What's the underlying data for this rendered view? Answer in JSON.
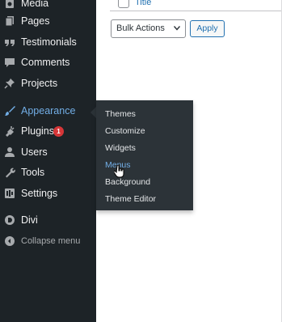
{
  "sidebar": {
    "items": [
      {
        "label": "Media",
        "icon": "media-icon"
      },
      {
        "label": "Pages",
        "icon": "pages-icon"
      },
      {
        "label": "Testimonials",
        "icon": "quote-icon"
      },
      {
        "label": "Comments",
        "icon": "comment-icon"
      },
      {
        "label": "Projects",
        "icon": "pin-icon"
      },
      {
        "label": "Appearance",
        "icon": "paintbrush-icon",
        "active": true
      },
      {
        "label": "Plugins",
        "icon": "plugin-icon",
        "badge": "1"
      },
      {
        "label": "Users",
        "icon": "user-icon"
      },
      {
        "label": "Tools",
        "icon": "wrench-icon"
      },
      {
        "label": "Settings",
        "icon": "settings-icon"
      },
      {
        "label": "Divi",
        "icon": "divi-icon"
      },
      {
        "label": "Collapse menu",
        "icon": "collapse-icon"
      }
    ]
  },
  "submenu": {
    "items": [
      {
        "label": "Themes"
      },
      {
        "label": "Customize"
      },
      {
        "label": "Widgets"
      },
      {
        "label": "Menus",
        "hover": true
      },
      {
        "label": "Background"
      },
      {
        "label": "Theme Editor"
      }
    ]
  },
  "main": {
    "title_column": "Title",
    "bulk_actions": "Bulk Actions",
    "apply": "Apply"
  },
  "colors": {
    "sidebar_bg": "#1d2327",
    "flyout_bg": "#2c3338",
    "accent": "#72aee6",
    "link": "#2271b1",
    "badge": "#d63638"
  }
}
